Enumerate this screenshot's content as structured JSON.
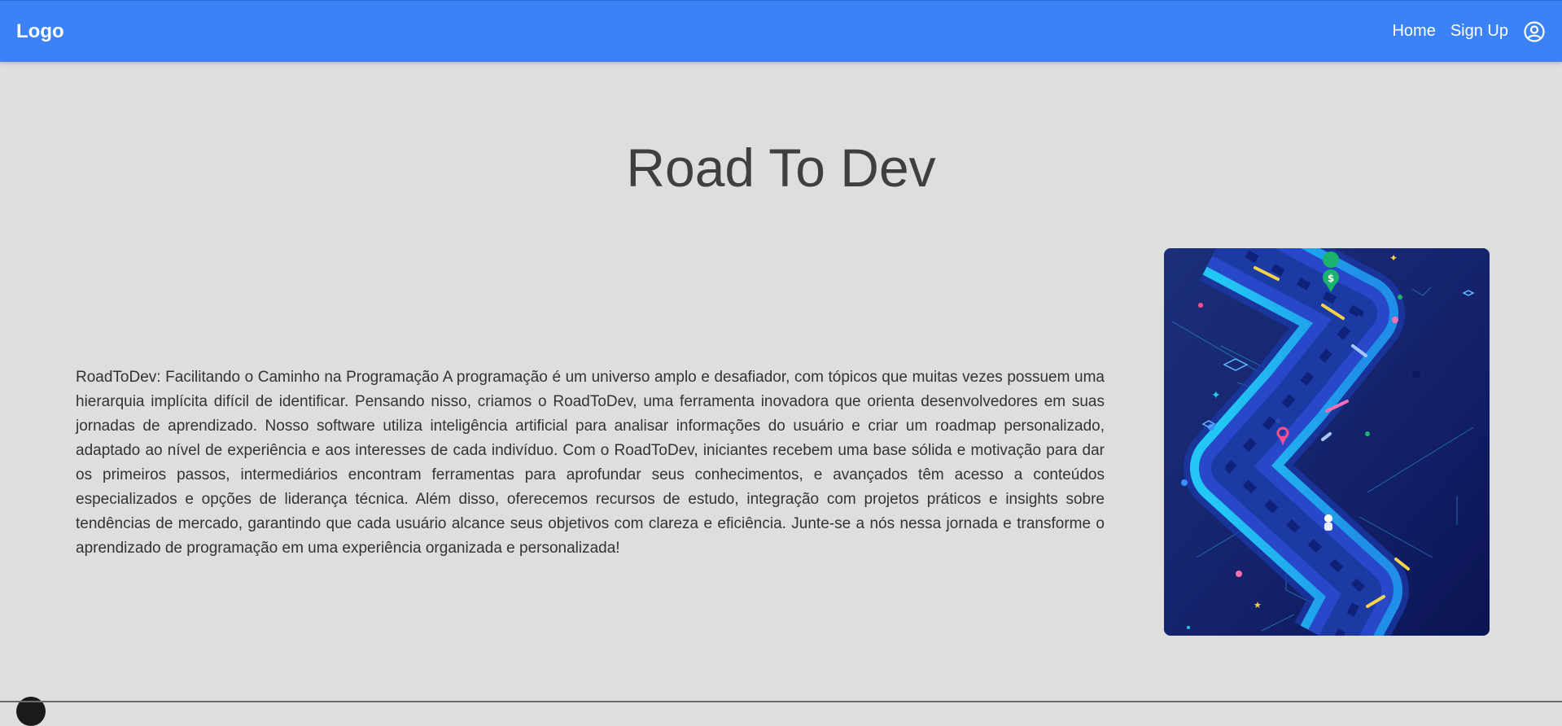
{
  "navbar": {
    "logo": "Logo",
    "links": [
      {
        "label": "Home"
      },
      {
        "label": "Sign Up"
      }
    ],
    "account_icon": "user-circle-icon"
  },
  "main": {
    "title": "Road To Dev",
    "description": "RoadToDev: Facilitando o Caminho na Programação A programação é um universo amplo e desafiador, com tópicos que muitas vezes possuem uma hierarquia implícita difícil de identificar. Pensando nisso, criamos o RoadToDev, uma ferramenta inovadora que orienta desenvolvedores em suas jornadas de aprendizado. Nosso software utiliza inteligência artificial para analisar informações do usuário e criar um roadmap personalizado, adaptado ao nível de experiência e aos interesses de cada indivíduo. Com o RoadToDev, iniciantes recebem uma base sólida e motivação para dar os primeiros passos, intermediários encontram ferramentas para aprofundar seus conhecimentos, e avançados têm acesso a conteúdos especializados e opções de liderança técnica. Além disso, oferecemos recursos de estudo, integração com projetos práticos e insights sobre tendências de mercado, garantindo que cada usuário alcance seus objetivos com clareza e eficiência. Junte-se a nós nessa jornada e transforme o aprendizado de programação em uma experiência organizada e personalizada!"
  },
  "colors": {
    "navbar": "#3b82f6",
    "background": "#dedede",
    "title": "#3f3f3f",
    "text": "#333333"
  }
}
